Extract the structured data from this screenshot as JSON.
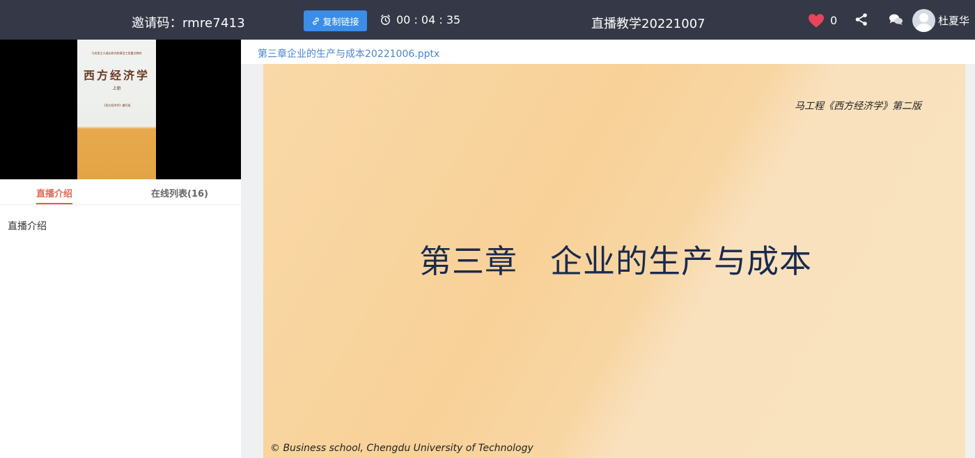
{
  "header": {
    "invite_label": "邀请码：",
    "invite_code": "rmre7413",
    "copy_link_label": "复制链接",
    "timer": "00 : 04 : 35",
    "live_title": "直播教学20221007",
    "like_count": "0",
    "user_name": "杜夏华"
  },
  "video": {
    "book_series_line": "马克思主义理论研究和建设工程重点教材",
    "book_title": "西方经济学",
    "book_volume": "上册",
    "book_editors": "《西方经济学》编写组"
  },
  "sidebar": {
    "tabs": [
      {
        "label": "直播介绍"
      },
      {
        "label": "在线列表(16)"
      }
    ],
    "intro_text": "直播介绍"
  },
  "document": {
    "filename": "第三章企业的生产与成本20221006.pptx"
  },
  "slide": {
    "subtitle": "马工程《西方经济学》第二版",
    "heading": "第三章　企业的生产与成本",
    "footer": "© Business school, Chengdu University of Technology"
  },
  "colors": {
    "topbar": "#353846",
    "accent_blue": "#3b8de9",
    "tab_active": "#e85a45",
    "heart": "#e8455a"
  }
}
